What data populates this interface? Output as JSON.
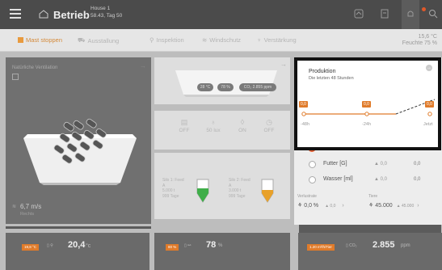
{
  "header": {
    "title": "Betrieb",
    "house_name": "House 1",
    "house_info": "58.43, Tag 50"
  },
  "toolbar": {
    "items": [
      {
        "label": "Mast stoppen"
      },
      {
        "label": "Ausstallung"
      },
      {
        "label": "Inspektion"
      },
      {
        "label": "Windschutz"
      },
      {
        "label": "Verstärkung"
      }
    ],
    "temp": "15,6 °C",
    "humidity": "Feuchte 75 %"
  },
  "left": {
    "label": "Natürliche Ventilation",
    "wind": "6,7 m/s",
    "wind_dir": "Rechts"
  },
  "mid": {
    "pills": [
      "28 °C",
      "78 %",
      "CO₂ 2.855 ppm"
    ],
    "stats": [
      "OFF",
      "50 lux",
      "ON",
      "OFF"
    ],
    "silo1": {
      "name": "Silo 1: Feed",
      "kind": "A",
      "amount": "5.000 t",
      "days": "999 Tage"
    },
    "silo2": {
      "name": "Silo 2: Feed",
      "kind": "A",
      "amount": "3.000 t",
      "days": "999 Tage"
    }
  },
  "production": {
    "title": "Produktion",
    "subtitle": "Die letzten 48 Stunden",
    "tags": [
      "0,0",
      "0,0",
      "0,0"
    ],
    "ticks": [
      "-48h",
      "-24h",
      "Jetzt"
    ],
    "rows": [
      {
        "label": "Futter [G]",
        "trend": "▲ 0,0",
        "value": "0,0"
      },
      {
        "label": "Wasser [ml]",
        "trend": "▲ 0,0",
        "value": "0,0"
      }
    ],
    "loss_label": "Verlustrate",
    "loss_value": "0,0 %",
    "loss_trend": "▲ 0,0",
    "animals_label": "Tiere",
    "animals_value": "45.000",
    "animals_trend": "▲ 45.000"
  },
  "bottom": {
    "temp_tag": "19,8 °C",
    "temp_value": "20,4",
    "hum_tag": "80 %",
    "hum_value": "78",
    "co2_tag": "1.20 m³/h/Tier",
    "co2_value": "2.855"
  },
  "colors": {
    "accent": "#e07b2a",
    "header": "#4b4b4b",
    "alert": "#e0592a"
  }
}
